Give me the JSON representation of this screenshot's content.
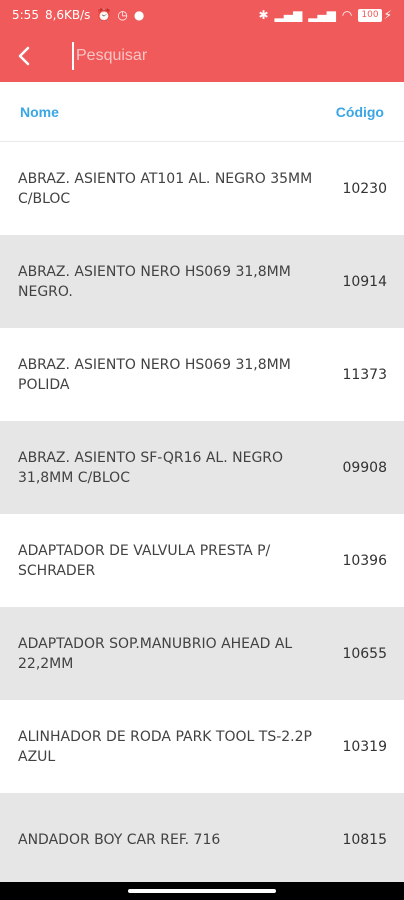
{
  "status_bar": {
    "time": "5:55",
    "speed": "8,6KB/s",
    "battery": "100"
  },
  "toolbar": {
    "search_placeholder": "Pesquisar"
  },
  "columns": {
    "name_label": "Nome",
    "code_label": "Código"
  },
  "items": [
    {
      "name": "ABRAZ. ASIENTO AT101 AL. NEGRO 35MM C/BLOC",
      "code": "10230"
    },
    {
      "name": "ABRAZ. ASIENTO NERO HS069 31,8MM NEGRO.",
      "code": "10914"
    },
    {
      "name": "ABRAZ. ASIENTO NERO HS069 31,8MM POLIDA",
      "code": "11373"
    },
    {
      "name": "ABRAZ. ASIENTO SF-QR16 AL. NEGRO 31,8MM C/BLOC",
      "code": "09908"
    },
    {
      "name": "ADAPTADOR DE VALVULA PRESTA P/ SCHRADER",
      "code": "10396"
    },
    {
      "name": "ADAPTADOR SOP.MANUBRIO AHEAD AL 22,2MM",
      "code": "10655"
    },
    {
      "name": "ALINHADOR DE RODA PARK TOOL TS-2.2P AZUL",
      "code": "10319"
    },
    {
      "name": "ANDADOR BOY CAR REF. 716",
      "code": "10815"
    }
  ],
  "colors": {
    "accent": "#f05a5a",
    "header_text": "#3aa6e6",
    "row_alt": "#e6e6e6"
  }
}
